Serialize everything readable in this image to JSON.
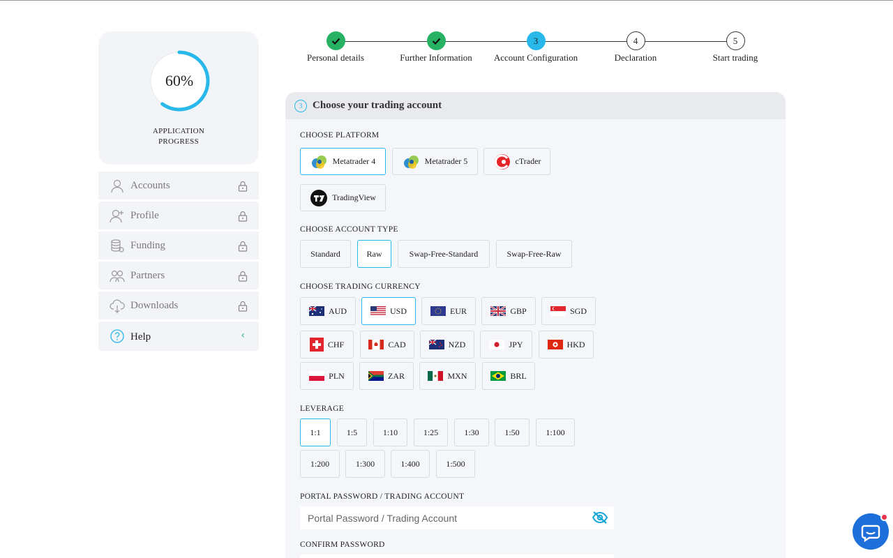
{
  "progress": {
    "percent_text": "60%",
    "percent_value": 0.6,
    "label_line1": "APPLICATION",
    "label_line2": "PROGRESS",
    "ring_color": "#29b8ea"
  },
  "sidebar": {
    "items": [
      {
        "label": "Accounts",
        "icon": "user-icon",
        "locked": true
      },
      {
        "label": "Profile",
        "icon": "user-plus-icon",
        "locked": true
      },
      {
        "label": "Funding",
        "icon": "coins-icon",
        "locked": true
      },
      {
        "label": "Partners",
        "icon": "users-icon",
        "locked": true
      },
      {
        "label": "Downloads",
        "icon": "cloud-download-icon",
        "locked": true
      },
      {
        "label": "Help",
        "icon": "help-circle-icon",
        "locked": false
      }
    ]
  },
  "stepper": {
    "steps": [
      {
        "label": "Personal details",
        "number": "1",
        "state": "done"
      },
      {
        "label": "Further Information",
        "number": "2",
        "state": "done"
      },
      {
        "label": "Account Configuration",
        "number": "3",
        "state": "active"
      },
      {
        "label": "Declaration",
        "number": "4",
        "state": "todo"
      },
      {
        "label": "Start trading",
        "number": "5",
        "state": "todo"
      }
    ]
  },
  "panel": {
    "step_number": "3",
    "title": "Choose your trading account",
    "platform_label": "CHOOSE PLATFORM",
    "platforms": [
      {
        "label": "Metatrader 4",
        "icon": "metatrader-icon",
        "selected": true
      },
      {
        "label": "Metatrader 5",
        "icon": "metatrader-icon",
        "selected": false
      },
      {
        "label": "cTrader",
        "icon": "ctrader-icon",
        "selected": false
      },
      {
        "label": "TradingView",
        "icon": "tradingview-icon",
        "selected": false
      }
    ],
    "account_type_label": "CHOOSE ACCOUNT TYPE",
    "account_types": [
      {
        "label": "Standard",
        "selected": false
      },
      {
        "label": "Raw",
        "selected": true
      },
      {
        "label": "Swap-Free-Standard",
        "selected": false
      },
      {
        "label": "Swap-Free-Raw",
        "selected": false
      }
    ],
    "currency_label": "CHOOSE TRADING CURRENCY",
    "currencies": [
      {
        "label": "AUD",
        "selected": false
      },
      {
        "label": "USD",
        "selected": true
      },
      {
        "label": "EUR",
        "selected": false
      },
      {
        "label": "GBP",
        "selected": false
      },
      {
        "label": "SGD",
        "selected": false
      },
      {
        "label": "CHF",
        "selected": false
      },
      {
        "label": "CAD",
        "selected": false
      },
      {
        "label": "NZD",
        "selected": false
      },
      {
        "label": "JPY",
        "selected": false
      },
      {
        "label": "HKD",
        "selected": false
      },
      {
        "label": "PLN",
        "selected": false
      },
      {
        "label": "ZAR",
        "selected": false
      },
      {
        "label": "MXN",
        "selected": false
      },
      {
        "label": "BRL",
        "selected": false
      }
    ],
    "leverage_label": "LEVERAGE",
    "leverages": [
      {
        "label": "1:1",
        "selected": true
      },
      {
        "label": "1:5",
        "selected": false
      },
      {
        "label": "1:10",
        "selected": false
      },
      {
        "label": "1:25",
        "selected": false
      },
      {
        "label": "1:30",
        "selected": false
      },
      {
        "label": "1:50",
        "selected": false
      },
      {
        "label": "1:100",
        "selected": false
      },
      {
        "label": "1:200",
        "selected": false
      },
      {
        "label": "1:300",
        "selected": false
      },
      {
        "label": "1:400",
        "selected": false
      },
      {
        "label": "1:500",
        "selected": false
      }
    ],
    "password_label": "PORTAL PASSWORD / TRADING ACCOUNT",
    "password_placeholder": "Portal Password / Trading Account",
    "password_value": "",
    "confirm_label": "CONFIRM PASSWORD"
  },
  "colors": {
    "accent": "#29b8ea",
    "done": "#27b163",
    "chat": "#1e6fd9",
    "notification": "#e8334a"
  }
}
